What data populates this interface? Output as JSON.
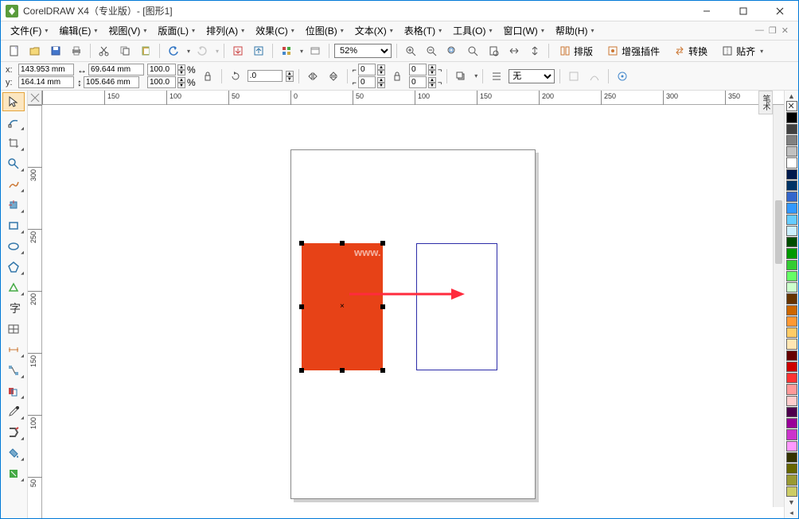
{
  "title": "CorelDRAW X4（专业版）- [图形1]",
  "menu": {
    "file": "文件(F)",
    "edit": "编辑(E)",
    "view": "视图(V)",
    "layout": "版面(L)",
    "arrange": "排列(A)",
    "effects": "效果(C)",
    "bitmaps": "位图(B)",
    "text": "文本(X)",
    "table": "表格(T)",
    "tools": "工具(O)",
    "window": "窗口(W)",
    "help": "帮助(H)"
  },
  "toolbar": {
    "zoom_value": "52%",
    "btn_paiban": "排版",
    "btn_plugin": "增强插件",
    "btn_convert": "转换",
    "btn_tieqi": "贴齐"
  },
  "props": {
    "x_label": "x:",
    "y_label": "y:",
    "x": "143.953 mm",
    "y": "164.14 mm",
    "w": "69.644 mm",
    "h": "105.646 mm",
    "sx": "100.0",
    "sy": "100.0",
    "pct": "%",
    "rot": ".0",
    "cx": "0",
    "cy": "0",
    "outline": "无"
  },
  "ruler_h": [
    "",
    "150",
    "100",
    "50",
    "0",
    "50",
    "100",
    "150",
    "200",
    "250",
    "300",
    "350"
  ],
  "ruler_v": [
    "",
    "300",
    "250",
    "200",
    "150",
    "100",
    "50"
  ],
  "watermark": "www.",
  "side_dock": "笔术",
  "palette": [
    "none",
    "#000000",
    "#404040",
    "#808080",
    "#c0c0c0",
    "#ffffff",
    "#001a4d",
    "#003366",
    "#3366cc",
    "#3399ff",
    "#66ccff",
    "#ccefff",
    "#004d00",
    "#009900",
    "#33cc33",
    "#66ff66",
    "#ccffcc",
    "#663300",
    "#cc6600",
    "#ff9933",
    "#ffcc66",
    "#ffe6b3",
    "#660000",
    "#cc0000",
    "#ff3333",
    "#ff9999",
    "#ffcccc",
    "#4d004d",
    "#990099",
    "#cc33cc",
    "#ff99ff",
    "#333300",
    "#666600",
    "#999933",
    "#cccc66"
  ]
}
